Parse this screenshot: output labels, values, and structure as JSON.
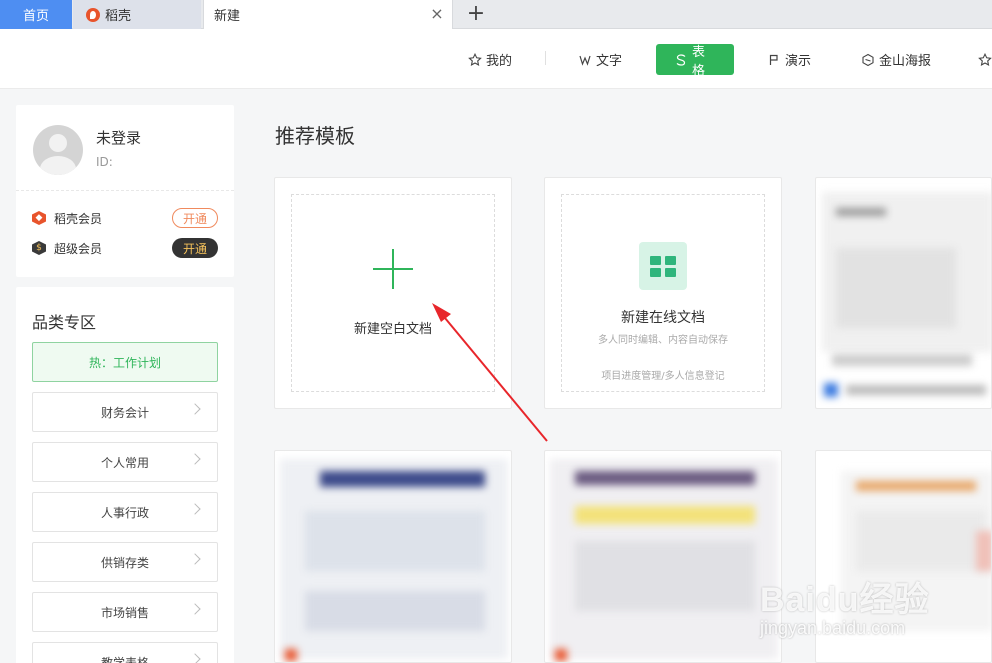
{
  "tabs": {
    "home": "首页",
    "daoke": "稻壳",
    "new": "新建",
    "close": "×",
    "add": "+"
  },
  "nav": {
    "mine": "我的",
    "text": "文字",
    "sheet": "表格",
    "present": "演示",
    "poster": "金山海报"
  },
  "user": {
    "name": "未登录",
    "id_label": "ID:",
    "members": [
      {
        "label": "稻壳会员",
        "button": "开通"
      },
      {
        "label": "超级会员",
        "button": "开通"
      }
    ]
  },
  "categories": {
    "title": "品类专区",
    "hot": "热：工作计划",
    "items": [
      "财务会计",
      "个人常用",
      "人事行政",
      "供销存类",
      "市场销售",
      "教学表格"
    ]
  },
  "main": {
    "title": "推荐模板",
    "blank_label": "新建空白文档",
    "online_label": "新建在线文档",
    "online_sub": "多人同时编辑、内容自动保存",
    "online_foot": "项目进度管理/多人信息登记"
  },
  "colors": {
    "accent_green": "#2fb55a",
    "tab_blue": "#4e8ef2",
    "arrow_red": "#e8262b"
  },
  "watermark": {
    "main": "Baidu经验",
    "sub": "jingyan.baidu.com"
  }
}
